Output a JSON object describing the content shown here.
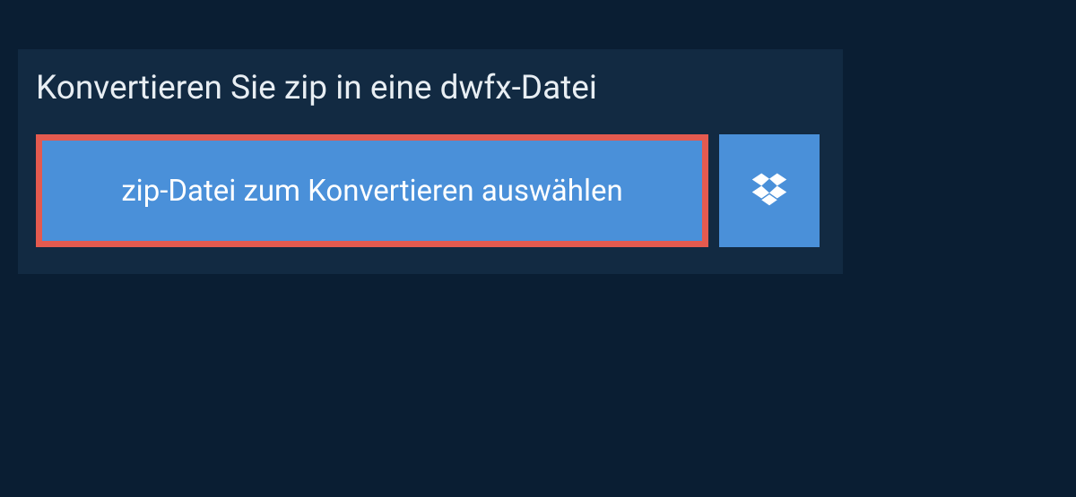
{
  "heading": "Konvertieren Sie zip in eine dwfx-Datei",
  "buttons": {
    "select_file": "zip-Datei zum Konvertieren auswählen"
  },
  "colors": {
    "page_bg": "#0a1e33",
    "panel_bg": "#122a42",
    "button_bg": "#4a90d9",
    "highlight_border": "#e45a4f",
    "text_light": "#e8eef3"
  }
}
